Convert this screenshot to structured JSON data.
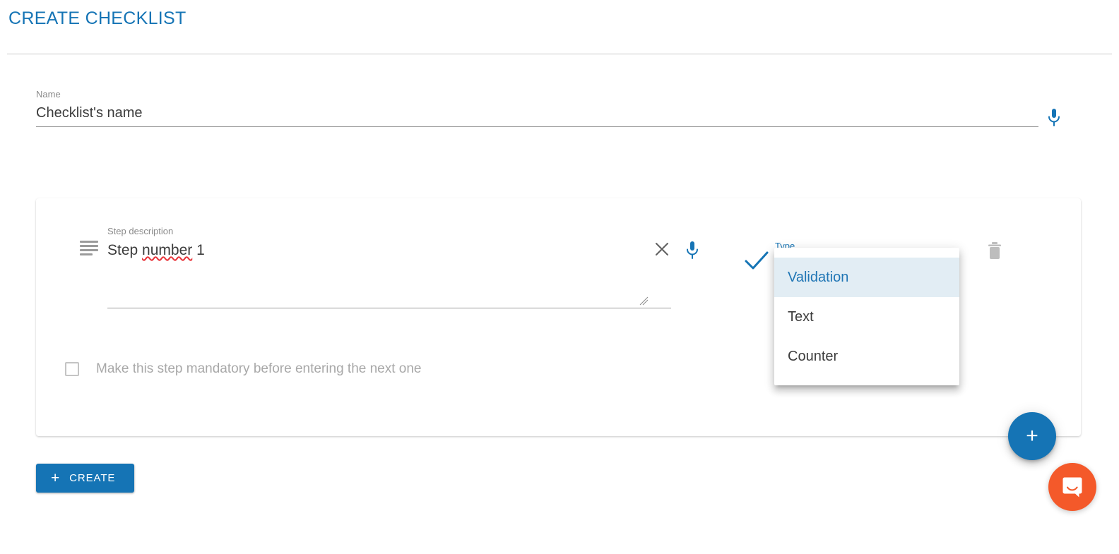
{
  "header": {
    "title": "CREATE CHECKLIST"
  },
  "name_field": {
    "label": "Name",
    "value": "Checklist's name",
    "placeholder": "Checklist's name",
    "mic_icon": "microphone-icon"
  },
  "step_card": {
    "drag_handle_icon": "drag-handle-icon",
    "description": {
      "label": "Step description",
      "text_before": "Step ",
      "text_misspelled": "number",
      "text_after": " 1",
      "full_text": "Step number 1"
    },
    "clear_icon": "close-icon",
    "mic_icon": "microphone-icon",
    "confirm_icon": "check-icon",
    "delete_icon": "trash-icon",
    "type_select": {
      "label": "Type",
      "selected": "Validation",
      "options": [
        {
          "label": "Validation",
          "selected": true
        },
        {
          "label": "Text",
          "selected": false
        },
        {
          "label": "Counter",
          "selected": false
        }
      ]
    },
    "mandatory": {
      "label": "Make this step mandatory before entering the next one",
      "checked": false
    }
  },
  "actions": {
    "create_label": "CREATE",
    "create_plus": "+",
    "fab_label": "+",
    "fab_icon": "plus-icon",
    "chat_icon": "chat-bubble-icon"
  },
  "colors": {
    "accent": "#1574b5",
    "option_selected_bg": "#e2edf4",
    "option_selected_text": "#2076b5",
    "muted_text": "#8a8a8a",
    "body_text": "#3c3c3c",
    "spellcheck": "#e8353b",
    "intercom": "#f4592a"
  }
}
